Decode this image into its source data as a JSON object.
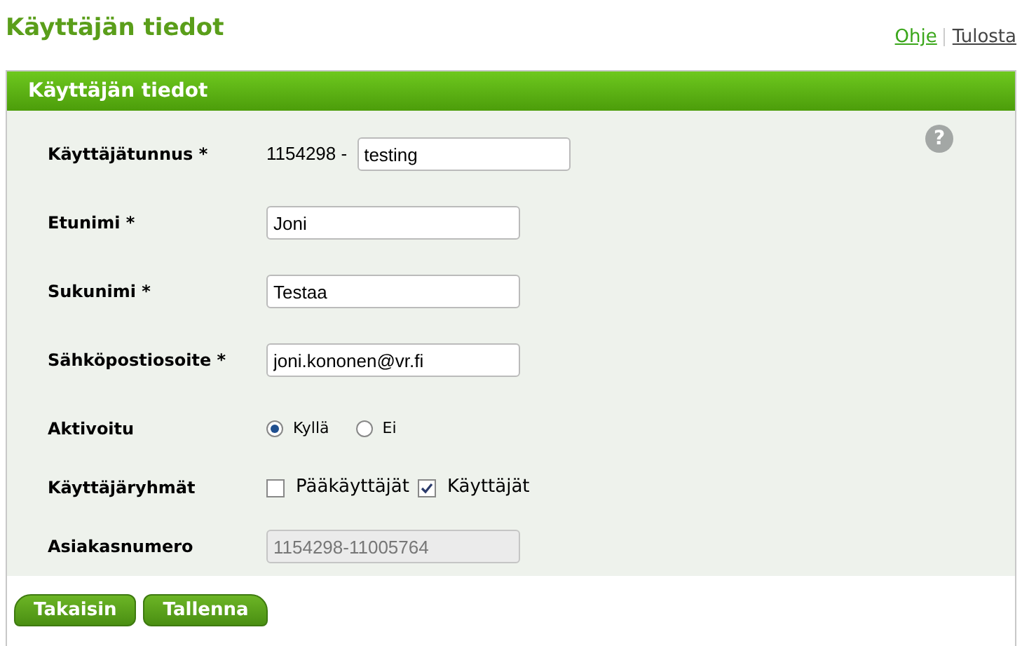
{
  "page_title": "Käyttäjän tiedot",
  "links": [
    {
      "label": "Ohje",
      "kind": "help"
    },
    {
      "label": "Tulosta",
      "kind": "print"
    }
  ],
  "panel": {
    "title": "Käyttäjän tiedot",
    "help_icon": "?",
    "fields": [
      {
        "kind": "text",
        "label": "Käyttäjätunnus *",
        "prefix": "1154298 -",
        "value": "testing"
      },
      {
        "kind": "text",
        "label": "Etunimi *",
        "value": "Joni"
      },
      {
        "kind": "text",
        "label": "Sukunimi *",
        "value": "Testaa"
      },
      {
        "kind": "text",
        "label": "Sähköpostiosoite *",
        "value": "joni.kononen@vr.fi"
      },
      {
        "kind": "radio",
        "label": "Aktivoitu",
        "options": [
          {
            "label": "Kyllä",
            "selected": true
          },
          {
            "label": "Ei",
            "selected": false
          }
        ]
      },
      {
        "kind": "checkbox",
        "label": "Käyttäjäryhmät",
        "options": [
          {
            "label": "Pääkäyttäjät",
            "checked": false
          },
          {
            "label": "Käyttäjät",
            "checked": true
          }
        ]
      },
      {
        "kind": "text",
        "label": "Asiakasnumero",
        "value": "1154298-11005764",
        "disabled": true
      }
    ]
  },
  "buttons": [
    "Takaisin",
    "Tallenna"
  ]
}
